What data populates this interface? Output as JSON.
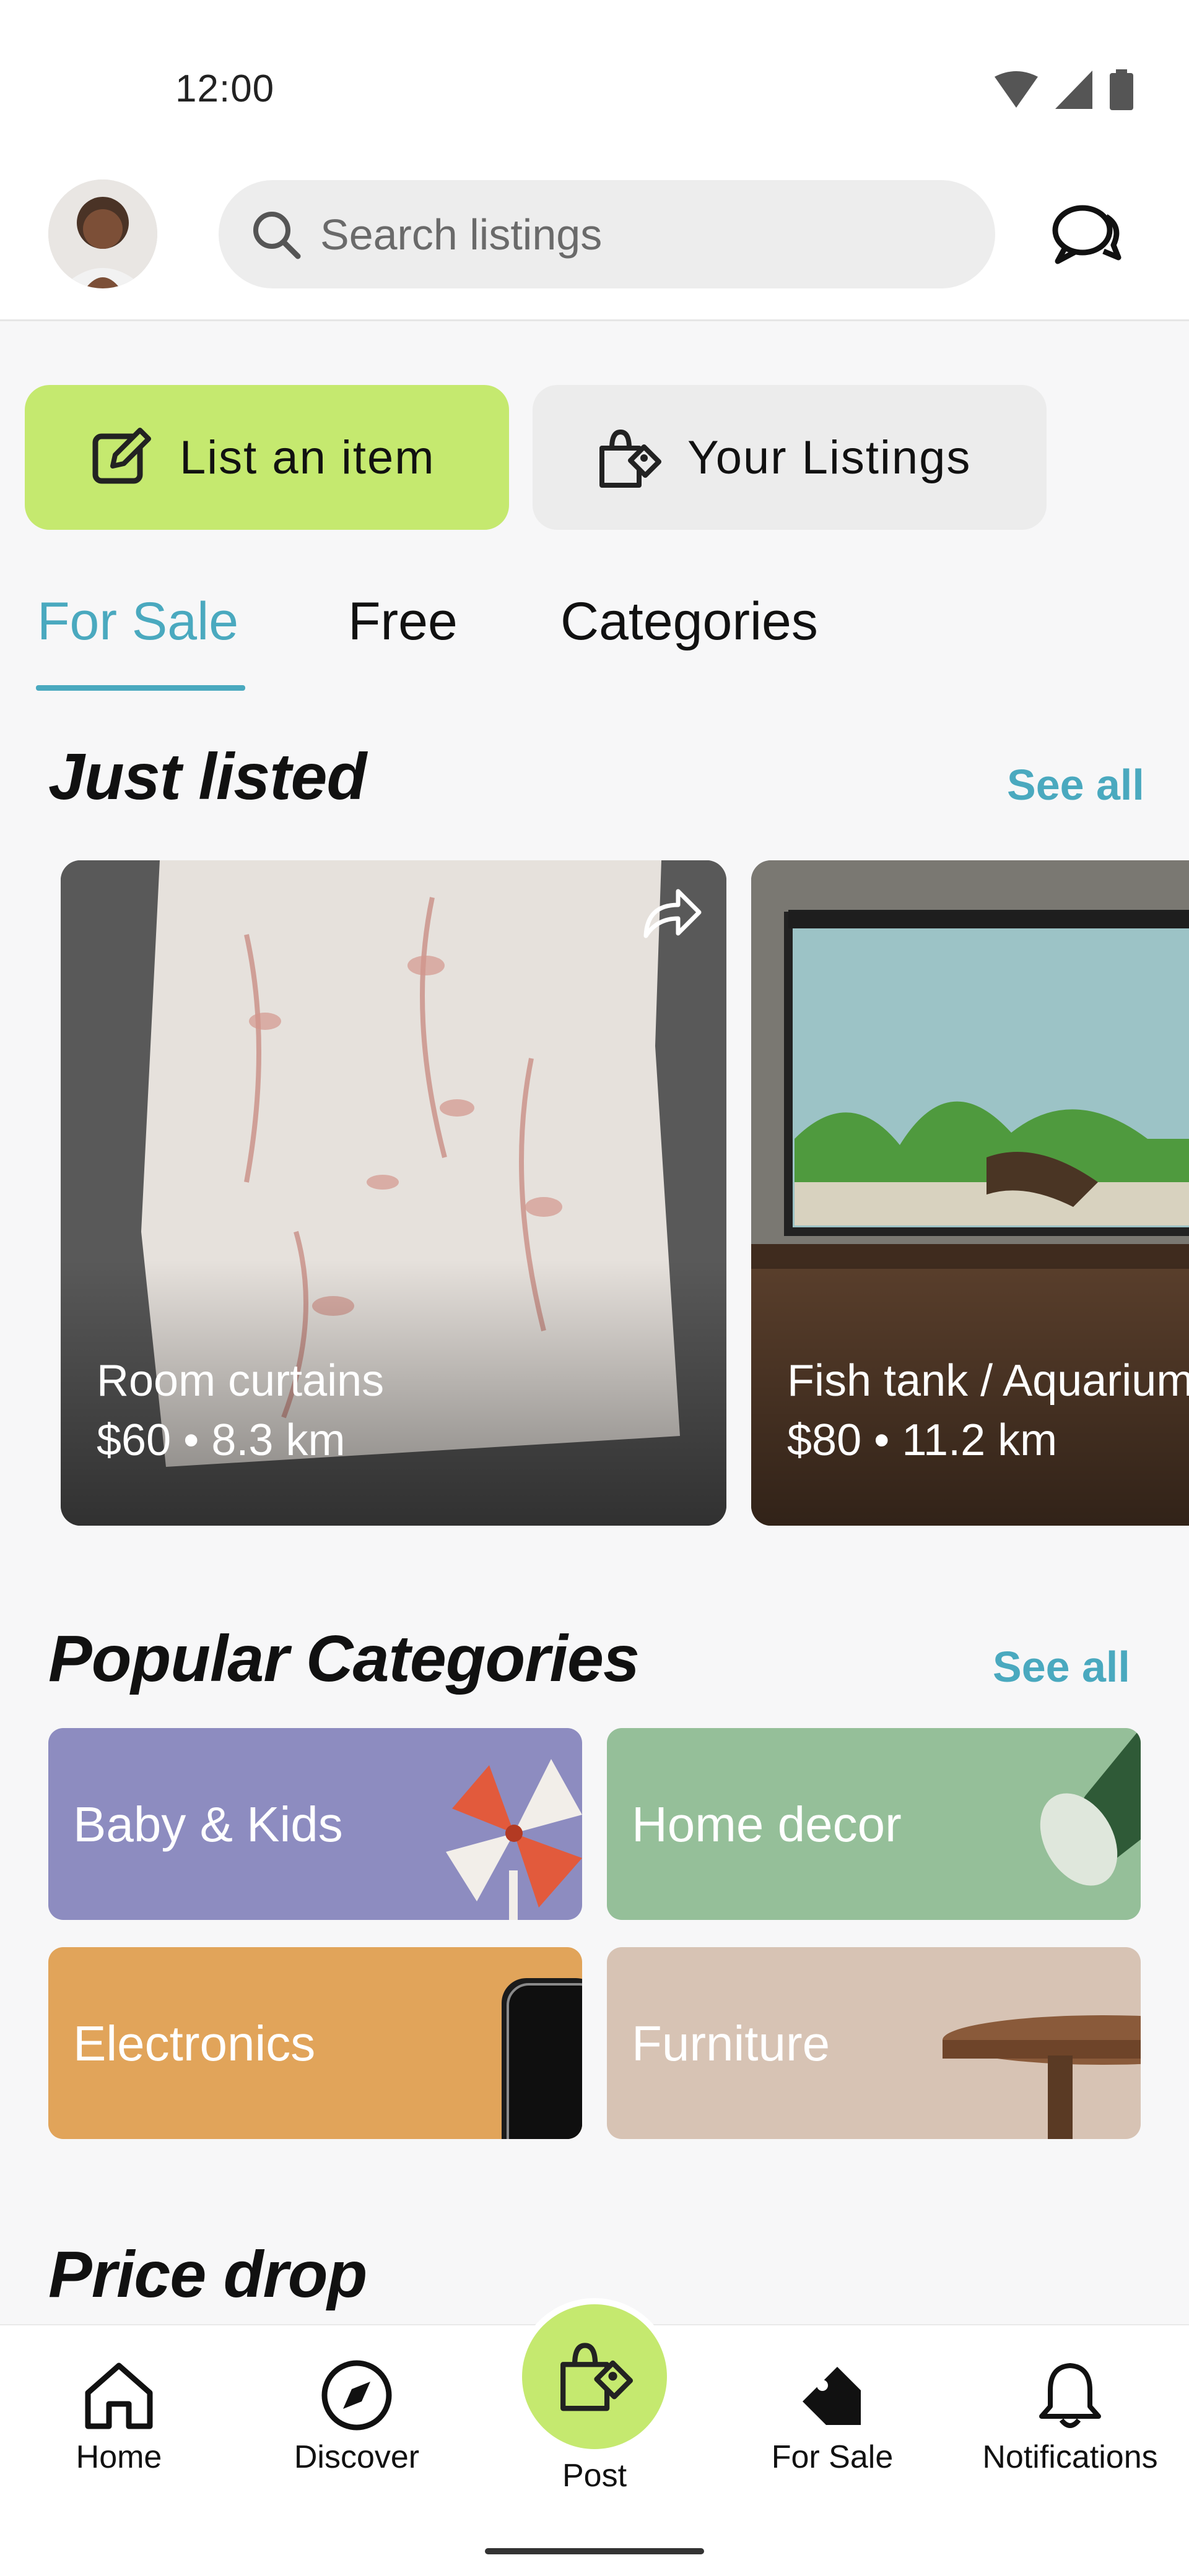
{
  "status": {
    "time": "12:00"
  },
  "header": {
    "search_placeholder": "Search listings"
  },
  "actions": {
    "list_item": "List an item",
    "your_listings": "Your Listings"
  },
  "tabs": [
    {
      "label": "For Sale",
      "active": true
    },
    {
      "label": "Free",
      "active": false
    },
    {
      "label": "Categories",
      "active": false
    }
  ],
  "just_listed": {
    "title": "Just listed",
    "see_all": "See all",
    "items": [
      {
        "title": "Room curtains",
        "price": "$60 • 8.3 km"
      },
      {
        "title": "Fish tank / Aquarium",
        "price": "$80 • 11.2 km"
      }
    ]
  },
  "popular_categories": {
    "title": "Popular Categories",
    "see_all": "See all",
    "items": [
      {
        "label": "Baby & Kids",
        "color": "#8d8cc0"
      },
      {
        "label": "Home decor",
        "color": "#95bf99"
      },
      {
        "label": "Electronics",
        "color": "#e1a45a"
      },
      {
        "label": "Furniture",
        "color": "#d7c3b4"
      }
    ]
  },
  "price_drop": {
    "title": "Price drop"
  },
  "bottom_nav": {
    "home": "Home",
    "discover": "Discover",
    "post": "Post",
    "for_sale": "For Sale",
    "notifications": "Notifications"
  },
  "colors": {
    "accent": "#4aa9bf",
    "green": "#c5e96f"
  }
}
